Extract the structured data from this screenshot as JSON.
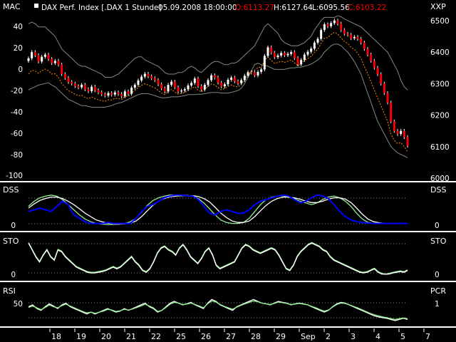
{
  "chart_data": [
    {
      "type": "candlestick",
      "panel": "price",
      "title": {
        "instrument": "DAX Perf. Index [.DAX  1 Stunde]",
        "datetime": "05.09.2008 18:00:00",
        "open": "O:6113.27",
        "high": "H:6127.64",
        "low": "L:6095.56",
        "close": "C:6103.22"
      },
      "left_axis_label": "MAC",
      "right_axis_label": "XXP",
      "left_ticks": [
        "40",
        "20",
        "0",
        "-20",
        "-40",
        "-60",
        "-80",
        "-100"
      ],
      "right_ticks": [
        "6500",
        "6400",
        "6300",
        "6200",
        "6100",
        "6000"
      ],
      "ylim": [
        6000,
        6520
      ],
      "close": [
        6380,
        6400,
        6390,
        6370,
        6385,
        6392,
        6378,
        6365,
        6372,
        6360,
        6330,
        6318,
        6305,
        6300,
        6292,
        6288,
        6296,
        6282,
        6276,
        6290,
        6279,
        6272,
        6266,
        6262,
        6270,
        6265,
        6272,
        6267,
        6260,
        6275,
        6268,
        6287,
        6296,
        6310,
        6322,
        6331,
        6323,
        6317,
        6311,
        6298,
        6285,
        6275,
        6296,
        6306,
        6288,
        6275,
        6278,
        6282,
        6294,
        6302,
        6316,
        6292,
        6281,
        6296,
        6311,
        6326,
        6319,
        6303,
        6291,
        6298,
        6312,
        6319,
        6307,
        6301,
        6311,
        6325,
        6336,
        6335,
        6326,
        6337,
        6345,
        6388,
        6415,
        6398,
        6384,
        6389,
        6397,
        6390,
        6394,
        6400,
        6381,
        6361,
        6375,
        6392,
        6401,
        6411,
        6430,
        6442,
        6470,
        6488,
        6482,
        6492,
        6500,
        6490,
        6470,
        6458,
        6455,
        6444,
        6448,
        6442,
        6430,
        6410,
        6392,
        6372,
        6350,
        6330,
        6300,
        6270,
        6240,
        6180,
        6150,
        6140,
        6150,
        6130,
        6103
      ],
      "upper_band": [
        6490,
        6495,
        6490,
        6480,
        6480,
        6480,
        6470,
        6460,
        6450,
        6430,
        6410,
        6400,
        6390,
        6380,
        6370,
        6360,
        6355,
        6355,
        6350,
        6345,
        6340,
        6335,
        6330,
        6320,
        6320,
        6320,
        6325,
        6330,
        6340,
        6350,
        6360,
        6370,
        6380,
        6385,
        6385,
        6375,
        6370,
        6365,
        6360,
        6355,
        6345,
        6335,
        6330,
        6330,
        6330,
        6335,
        6335,
        6340,
        6350,
        6355,
        6350,
        6340,
        6335,
        6345,
        6355,
        6365,
        6370,
        6370,
        6365,
        6360,
        6360,
        6365,
        6365,
        6370,
        6380,
        6390,
        6400,
        6410,
        6420,
        6440,
        6460,
        6480,
        6490,
        6480,
        6470,
        6460,
        6440,
        6430,
        6425,
        6420,
        6420,
        6420,
        6425,
        6430,
        6440,
        6450,
        6470,
        6485,
        6500,
        6510,
        6510,
        6510,
        6510,
        6515,
        6512,
        6505,
        6500,
        6495,
        6490,
        6485,
        6480,
        6470,
        6460,
        6450,
        6440,
        6430,
        6420,
        6410,
        6400,
        6380,
        6360,
        6340,
        6310,
        6290,
        6280
      ],
      "lower_band": [
        6280,
        6285,
        6290,
        6295,
        6298,
        6300,
        6303,
        6295,
        6290,
        6280,
        6270,
        6260,
        6250,
        6245,
        6240,
        6235,
        6230,
        6230,
        6228,
        6225,
        6225,
        6225,
        6225,
        6225,
        6228,
        6230,
        6235,
        6238,
        6240,
        6245,
        6250,
        6255,
        6260,
        6265,
        6268,
        6268,
        6268,
        6265,
        6262,
        6258,
        6255,
        6255,
        6256,
        6258,
        6258,
        6258,
        6260,
        6262,
        6265,
        6265,
        6265,
        6266,
        6266,
        6268,
        6270,
        6272,
        6272,
        6272,
        6270,
        6270,
        6270,
        6272,
        6275,
        6278,
        6285,
        6300,
        6320,
        6340,
        6360,
        6365,
        6360,
        6358,
        6355,
        6350,
        6345,
        6345,
        6345,
        6345,
        6348,
        6350,
        6350,
        6352,
        6352,
        6355,
        6358,
        6362,
        6368,
        6375,
        6385,
        6400,
        6410,
        6420,
        6425,
        6425,
        6420,
        6410,
        6400,
        6385,
        6370,
        6350,
        6330,
        6300,
        6270,
        6240,
        6210,
        6180,
        6160,
        6140,
        6120,
        6100,
        6090,
        6080,
        6075,
        6070,
        6065
      ]
    },
    {
      "type": "line",
      "panel": "DSS",
      "left_label": "DSS",
      "right_label": "DSS",
      "right_ticks": [
        "0"
      ],
      "ylim": [
        0,
        100
      ],
      "series": [
        {
          "values": [
            55,
            70,
            80,
            85,
            88,
            85,
            75,
            60,
            45,
            30,
            18,
            10,
            5,
            3,
            2,
            2,
            3,
            5,
            10,
            20,
            38,
            58,
            72,
            80,
            85,
            88,
            88,
            88,
            87,
            85,
            78,
            65,
            48,
            30,
            15,
            8,
            5,
            5,
            8,
            20,
            40,
            60,
            75,
            82,
            85,
            86,
            82,
            78,
            70,
            65,
            60,
            65,
            75,
            82,
            85,
            80,
            70,
            55,
            35,
            18,
            8,
            5,
            5,
            5,
            5,
            5,
            5,
            5
          ]
        },
        {
          "values": [
            50,
            62,
            72,
            78,
            82,
            82,
            78,
            70,
            60,
            48,
            35,
            25,
            15,
            10,
            6,
            4,
            3,
            4,
            6,
            12,
            25,
            42,
            58,
            70,
            78,
            83,
            85,
            86,
            86,
            86,
            84,
            78,
            68,
            52,
            35,
            22,
            12,
            8,
            8,
            12,
            25,
            42,
            58,
            70,
            78,
            82,
            82,
            80,
            76,
            70,
            66,
            66,
            70,
            76,
            80,
            80,
            76,
            66,
            50,
            32,
            18,
            10,
            7,
            5,
            5,
            5,
            5,
            5
          ]
        },
        {
          "values": [
            40,
            45,
            50,
            45,
            40,
            55,
            70,
            60,
            30,
            20,
            10,
            5,
            5,
            5,
            8,
            5,
            5,
            5,
            5,
            20,
            40,
            55,
            60,
            70,
            80,
            85,
            88,
            88,
            86,
            85,
            75,
            55,
            35,
            30,
            40,
            45,
            40,
            35,
            35,
            45,
            60,
            70,
            75,
            80,
            85,
            88,
            85,
            75,
            65,
            70,
            80,
            88,
            85,
            78,
            60,
            40,
            25,
            15,
            10,
            8,
            6,
            5,
            5,
            5,
            5,
            5,
            5,
            5
          ]
        }
      ]
    },
    {
      "type": "line",
      "panel": "STO",
      "left_label": "STO",
      "right_label": "STO",
      "right_ticks": [
        "0"
      ],
      "ylim": [
        0,
        100
      ],
      "series": [
        {
          "values": [
            95,
            75,
            55,
            40,
            60,
            75,
            55,
            45,
            75,
            70,
            55,
            45,
            35,
            25,
            20,
            15,
            10,
            8,
            8,
            10,
            12,
            15,
            20,
            25,
            20,
            25,
            35,
            45,
            55,
            40,
            30,
            15,
            10,
            20,
            40,
            65,
            80,
            85,
            75,
            70,
            60,
            80,
            90,
            75,
            55,
            45,
            35,
            50,
            70,
            80,
            60,
            30,
            20,
            25,
            30,
            35,
            40,
            60,
            80,
            90,
            85,
            75,
            70,
            65,
            70,
            75,
            80,
            75,
            60,
            40,
            20,
            15,
            30,
            55,
            70,
            80,
            90,
            95,
            90,
            85,
            75,
            70,
            55,
            45,
            40,
            35,
            30,
            25,
            20,
            15,
            10,
            8,
            10,
            15,
            20,
            10,
            5,
            3,
            5,
            8,
            10,
            12,
            10,
            15
          ]
        },
        {
          "values": [
            93,
            73,
            53,
            38,
            58,
            73,
            53,
            43,
            73,
            68,
            53,
            43,
            33,
            23,
            18,
            13,
            8,
            6,
            6,
            8,
            10,
            13,
            18,
            23,
            18,
            23,
            33,
            43,
            53,
            38,
            28,
            13,
            8,
            18,
            38,
            63,
            78,
            83,
            73,
            68,
            58,
            78,
            88,
            73,
            53,
            43,
            33,
            48,
            68,
            78,
            58,
            28,
            18,
            23,
            28,
            33,
            38,
            58,
            78,
            88,
            83,
            73,
            68,
            63,
            68,
            73,
            78,
            73,
            58,
            38,
            18,
            13,
            28,
            53,
            68,
            78,
            88,
            93,
            88,
            83,
            73,
            68,
            53,
            43,
            38,
            33,
            28,
            23,
            18,
            13,
            8,
            6,
            8,
            13,
            18,
            8,
            3,
            2,
            3,
            6,
            8,
            10,
            8,
            13
          ]
        }
      ]
    },
    {
      "type": "line",
      "panel": "RSI",
      "left_label": "RSI",
      "right_label": "PCR",
      "left_ticks": [
        "50"
      ],
      "right_ticks": [
        "1"
      ],
      "ylim": [
        0,
        100
      ],
      "series": [
        {
          "values": [
            50,
            55,
            45,
            40,
            50,
            58,
            52,
            45,
            55,
            60,
            50,
            45,
            40,
            35,
            30,
            35,
            30,
            35,
            40,
            45,
            40,
            35,
            38,
            45,
            40,
            45,
            50,
            55,
            60,
            50,
            45,
            35,
            40,
            50,
            60,
            65,
            60,
            55,
            58,
            62,
            55,
            50,
            45,
            60,
            70,
            65,
            55,
            50,
            45,
            40,
            50,
            55,
            60,
            65,
            70,
            65,
            60,
            58,
            55,
            60,
            65,
            62,
            60,
            55,
            58,
            60,
            58,
            55,
            50,
            45,
            40,
            35,
            40,
            50,
            58,
            62,
            60,
            55,
            50,
            45,
            40,
            35,
            30,
            25,
            22,
            20,
            18,
            15,
            12,
            15,
            18,
            15
          ]
        },
        {
          "values": [
            48,
            52,
            47,
            42,
            48,
            55,
            50,
            47,
            53,
            57,
            52,
            47,
            42,
            37,
            33,
            35,
            32,
            35,
            38,
            43,
            41,
            37,
            39,
            43,
            41,
            44,
            48,
            52,
            57,
            52,
            47,
            37,
            40,
            48,
            57,
            62,
            60,
            56,
            57,
            60,
            56,
            52,
            47,
            58,
            66,
            63,
            56,
            51,
            47,
            43,
            49,
            54,
            58,
            62,
            66,
            64,
            60,
            58,
            56,
            59,
            63,
            61,
            59,
            56,
            57,
            59,
            57,
            55,
            51,
            47,
            42,
            38,
            41,
            49,
            56,
            60,
            59,
            55,
            51,
            47,
            42,
            37,
            32,
            28,
            25,
            22,
            20,
            17,
            15,
            17,
            19,
            17
          ]
        }
      ]
    }
  ],
  "x_axis": {
    "labels": [
      "18",
      "19",
      "20",
      "21",
      "22",
      "25",
      "26",
      "27",
      "28",
      "29",
      "Sep",
      "2",
      "3",
      "4",
      "5",
      "7"
    ]
  },
  "colors": {
    "background": "#000000",
    "bull_candle": "#ffffff",
    "bear_candle": "#ff0000",
    "band": "#7f8c7f",
    "dotted_line": "#ff8c00",
    "accent_line": "#ffffff",
    "green_line": "#90ee90",
    "blue_line": "#0000ff",
    "title_red": "#ff0000",
    "text": "#ffffff"
  }
}
